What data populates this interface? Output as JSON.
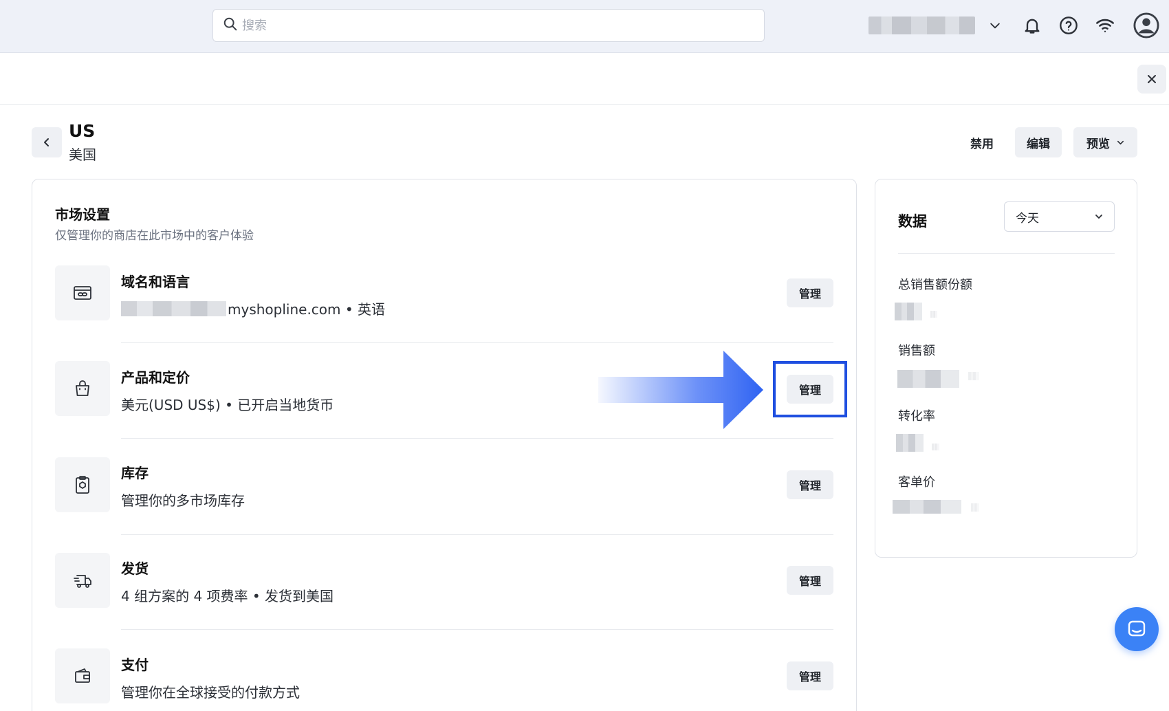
{
  "topbar": {
    "search_placeholder": "搜索",
    "icons": [
      "search-icon",
      "chevron-down-icon",
      "bell-icon",
      "help-icon",
      "wifi-icon",
      "user-avatar-icon"
    ]
  },
  "page": {
    "title": "US",
    "subtitle": "美国",
    "actions": {
      "disable": "禁用",
      "edit": "编辑",
      "preview": "预览"
    }
  },
  "market_settings": {
    "title": "市场设置",
    "description": "仅管理你的商店在此市场中的客户体验",
    "manage_label": "管理",
    "rows": [
      {
        "title": "域名和语言",
        "desc_suffix": "myshopline.com • 英语",
        "icon": "domain-link-icon"
      },
      {
        "title": "产品和定价",
        "desc": "美元(USD US$) • 已开启当地货币",
        "icon": "shopping-bag-icon"
      },
      {
        "title": "库存",
        "desc": "管理你的多市场库存",
        "icon": "inventory-clipboard-icon"
      },
      {
        "title": "发货",
        "desc": "4 组方案的 4 项费率 • 发货到美国",
        "icon": "delivery-truck-icon"
      },
      {
        "title": "支付",
        "desc": "管理你在全球接受的付款方式",
        "icon": "wallet-icon"
      }
    ]
  },
  "data_panel": {
    "title": "数据",
    "period": "今天",
    "metrics": [
      "总销售额份额",
      "销售额",
      "转化率",
      "客单价"
    ]
  },
  "colors": {
    "accent": "#3b82f6",
    "highlight": "#1f4fe0",
    "button_bg": "#eef0f4"
  }
}
